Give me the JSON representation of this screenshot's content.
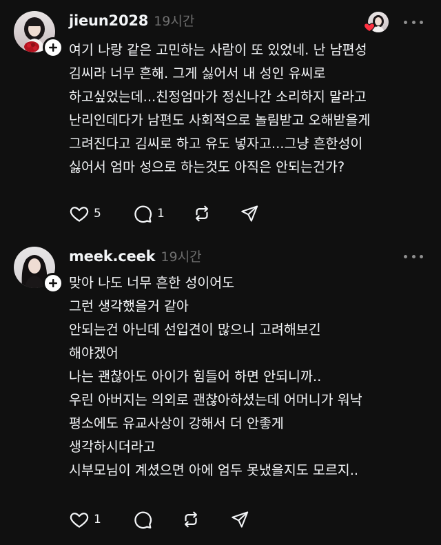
{
  "posts": [
    {
      "username": "jieun2028",
      "time": "19시간",
      "lines": [
        "여기 나랑 같은 고민하는 사람이 또 있었네. 난 남편성",
        "김씨라 너무 흔해. 그게 싫어서 내 성인 유씨로",
        "하고싶었는데...친정엄마가 정신나간 소리하지 말라고",
        "난리인데다가 남편도 사회적으로 놀림받고 오해받을게",
        "그려진다고 김씨로 하고 유도 넣자고...그냥 흔한성이",
        "싫어서 엄마 성으로 하는것도 아직은 안되는건가?"
      ],
      "likes": "5",
      "comments": "1",
      "liked_by_author": true
    },
    {
      "username": "meek.ceek",
      "time": "19시간",
      "lines": [
        "맞아 나도 너무 흔한 성이어도",
        "그런 생각했을거 같아",
        "안되는건 아닌데 선입견이 많으니 고려해보긴",
        "해야겠어",
        "나는 괜찮아도 아이가 힘들어 하면 안되니까..",
        "우린 아버지는 의외로 괜찮아하셨는데 어머니가 워낙",
        "평소에도 유교사상이 강해서 더 안좋게",
        "생각하시더라고",
        "시부모님이 계셨으면 아에 엄두 못냈을지도 모르지.."
      ],
      "likes": "1",
      "comments": "",
      "liked_by_author": false
    }
  ],
  "icons": {
    "like": "heart-outline-icon",
    "comment": "speech-bubble-icon",
    "repost": "repost-arrows-icon",
    "share": "paper-plane-icon",
    "more": "more-dots-icon",
    "follow": "plus-icon",
    "liked_heart": "heart-filled-icon"
  },
  "colors": {
    "background": "#101010",
    "text": "#f3f5f7",
    "muted": "#6f6f6f",
    "heart_red": "#ff3040"
  }
}
